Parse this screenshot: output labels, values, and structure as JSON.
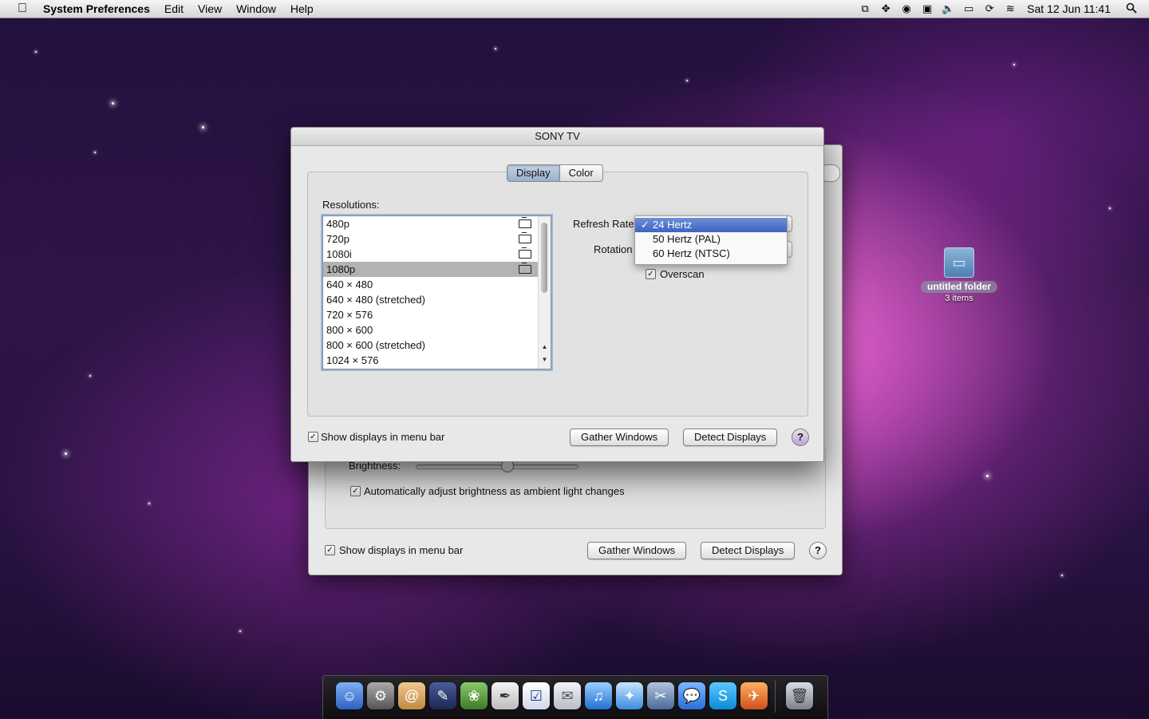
{
  "menubar": {
    "apple": "",
    "app_name": "System Preferences",
    "items": [
      "Edit",
      "View",
      "Window",
      "Help"
    ],
    "clock": "Sat 12 Jun  11:41"
  },
  "sheet": {
    "title": "SONY TV",
    "tabs": [
      "Display",
      "Color"
    ],
    "active_tab": "Display",
    "resolutions_label": "Resolutions:",
    "resolutions": [
      {
        "label": "480p",
        "tv": true
      },
      {
        "label": "720p",
        "tv": true
      },
      {
        "label": "1080i",
        "tv": true
      },
      {
        "label": "1080p",
        "tv": true,
        "selected": true
      },
      {
        "label": "640 × 480"
      },
      {
        "label": "640 × 480 (stretched)"
      },
      {
        "label": "720 × 576"
      },
      {
        "label": "800 × 600"
      },
      {
        "label": "800 × 600 (stretched)"
      },
      {
        "label": "1024 × 576"
      }
    ],
    "refresh_rate_label": "Refresh Rate",
    "refresh_options": [
      "24 Hertz",
      "50 Hertz (PAL)",
      "60 Hertz (NTSC)"
    ],
    "refresh_selected": "24 Hertz",
    "check_mark": "✓",
    "rotation_label": "Rotation",
    "overscan_label": "Overscan",
    "overscan_checked": true,
    "show_in_menubar": "Show displays in menu bar",
    "gather_windows": "Gather Windows",
    "detect_displays": "Detect Displays",
    "help": "?"
  },
  "back_window": {
    "brightness_label": "Brightness:",
    "brightness_level": 0.57,
    "auto_brightness": "Automatically adjust brightness as ambient light changes",
    "show_in_menubar": "Show displays in menu bar",
    "gather_windows": "Gather Windows",
    "detect_displays": "Detect Displays",
    "help": "?"
  },
  "desktop": {
    "folder_name": "untitled folder",
    "folder_info": "3 items"
  }
}
